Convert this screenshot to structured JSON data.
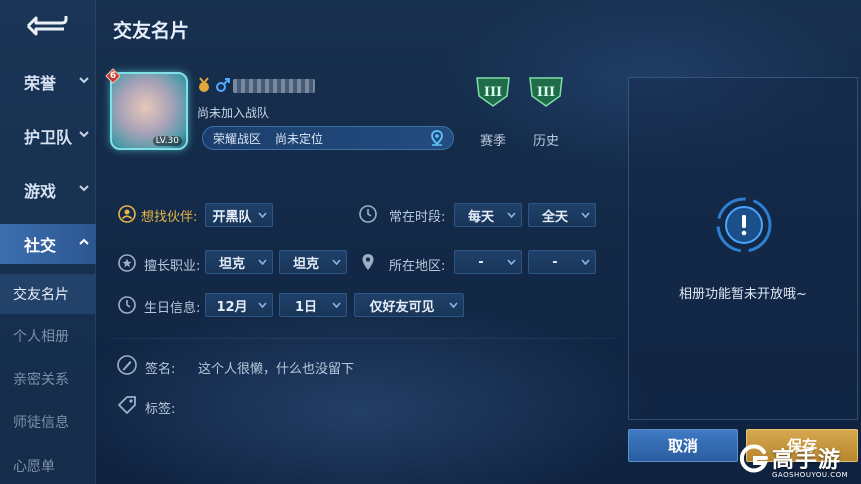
{
  "header": {
    "title": "交友名片"
  },
  "sidebar": {
    "items": [
      {
        "label": "荣誉"
      },
      {
        "label": "护卫队"
      },
      {
        "label": "游戏"
      },
      {
        "label": "社交"
      }
    ],
    "subitems": [
      {
        "label": "交友名片"
      },
      {
        "label": "个人相册"
      },
      {
        "label": "亲密关系"
      },
      {
        "label": "师徒信息"
      },
      {
        "label": "心愿单"
      }
    ]
  },
  "profile": {
    "rank_badge": "6",
    "avatar_level": "LV.30",
    "team_status": "尚未加入战队",
    "zone": "荣耀战区",
    "zone_status": "尚未定位",
    "season_label": "赛季",
    "history_label": "历史",
    "season_tier": "III",
    "history_tier": "III"
  },
  "form": {
    "partner_label": "想找伙伴:",
    "partner_value": "开黑队",
    "time_label": "常在时段:",
    "time_day": "每天",
    "time_range": "全天",
    "role_label": "擅长职业:",
    "role_1": "坦克",
    "role_2": "坦克",
    "region_label": "所在地区:",
    "region_1": "-",
    "region_2": "-",
    "birthday_label": "生日信息:",
    "birthday_month": "12月",
    "birthday_day": "1日",
    "birthday_visibility": "仅好友可见",
    "signature_label": "签名:",
    "signature_value": "这个人很懒，什么也没留下",
    "tags_label": "标签:"
  },
  "album": {
    "message": "相册功能暂未开放哦~"
  },
  "actions": {
    "cancel": "取消",
    "save": "保存"
  },
  "watermark": {
    "main": "高手游",
    "sub": "GAOSHOUYOU.COM"
  },
  "colors": {
    "accent_gold": "#e8b54a",
    "primary_blue": "#3f7ac4",
    "save_gold": "#d6a850"
  }
}
